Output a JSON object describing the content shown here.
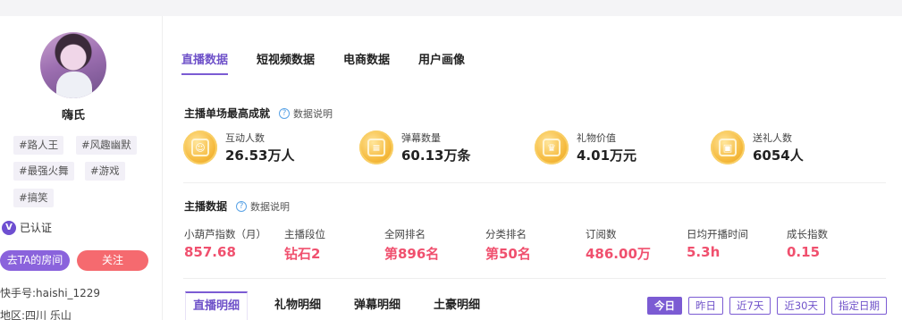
{
  "profile": {
    "name": "嗨氏",
    "tags": [
      "#路人王",
      "#风趣幽默",
      "#最强火舞",
      "#游戏",
      "#搞笑"
    ],
    "verified_label": "已认证",
    "verified_icon": "V",
    "visit_room_label": "去TA的房间",
    "follow_label": "关注",
    "kuaishou_id": "快手号:haishi_1229",
    "region": "地区:四川 乐山"
  },
  "tabs": [
    "直播数据",
    "短视频数据",
    "电商数据",
    "用户画像"
  ],
  "active_tab": 0,
  "achievements_section": {
    "title": "主播单场最高成就",
    "help_label": "数据说明",
    "items": [
      {
        "label": "互动人数",
        "value": "26.53万人",
        "icon": "interaction-medal-icon"
      },
      {
        "label": "弹幕数量",
        "value": "60.13万条",
        "icon": "danmaku-medal-icon"
      },
      {
        "label": "礼物价值",
        "value": "4.01万元",
        "icon": "gift-medal-icon"
      },
      {
        "label": "送礼人数",
        "value": "6054人",
        "icon": "gifter-medal-icon"
      }
    ]
  },
  "metrics_section": {
    "title": "主播数据",
    "help_label": "数据说明",
    "items": [
      {
        "label": "小葫芦指数（月）",
        "value": "857.68"
      },
      {
        "label": "主播段位",
        "value": "钻石2"
      },
      {
        "label": "全网排名",
        "value": "第896名"
      },
      {
        "label": "分类排名",
        "value": "第50名"
      },
      {
        "label": "订阅数",
        "value": "486.00万"
      },
      {
        "label": "日均开播时间",
        "value": "5.3h"
      },
      {
        "label": "成长指数",
        "value": "0.15"
      }
    ]
  },
  "detail_tabs": [
    "直播明细",
    "礼物明细",
    "弹幕明细",
    "土豪明细"
  ],
  "range_buttons": [
    "今日",
    "昨日",
    "近7天",
    "近30天",
    "指定日期"
  ],
  "colors": {
    "accent": "#7b5bd3",
    "value_red": "#f0506e",
    "follow": "#f56a6f"
  }
}
